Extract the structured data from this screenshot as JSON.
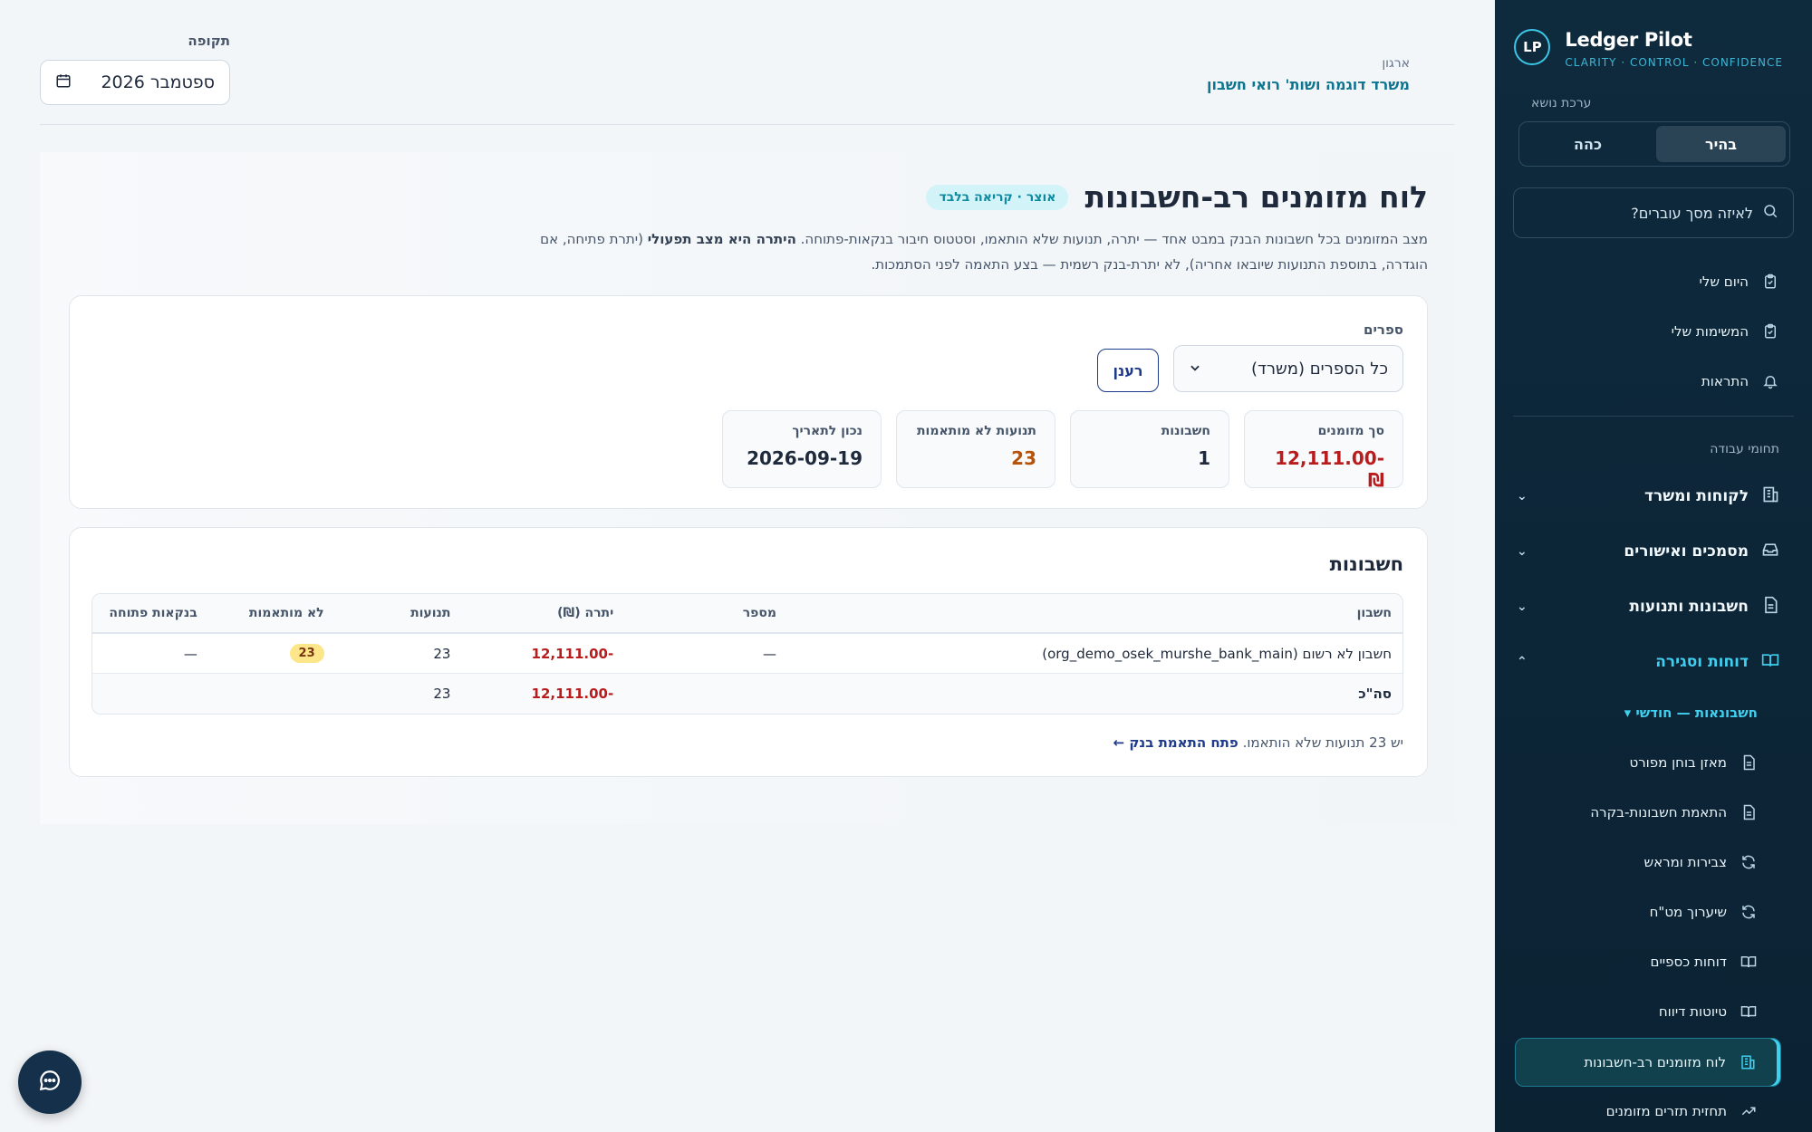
{
  "brand": {
    "initials": "LP",
    "name": "Ledger Pilot",
    "tagline": "CLARITY · CONTROL · CONFIDENCE"
  },
  "sidebar": {
    "theme_label": "ערכת נושא",
    "theme_options": [
      "בהיר",
      "כהה"
    ],
    "search_placeholder": "לאיזה מסך עוברים?",
    "personal": [
      {
        "label": "היום שלי",
        "icon": "clipboard-check-icon"
      },
      {
        "label": "המשימות שלי",
        "icon": "clipboard-check-icon"
      },
      {
        "label": "התראות",
        "icon": "bell-icon"
      }
    ],
    "section_label": "תחומי עבודה",
    "groups": [
      {
        "label": "לקוחות ומשרד",
        "icon": "building-icon"
      },
      {
        "label": "מסמכים ואישורים",
        "icon": "inbox-icon"
      },
      {
        "label": "חשבונות ותנועות",
        "icon": "document-icon"
      },
      {
        "label": "דוחות וסגירה",
        "icon": "book-icon"
      }
    ],
    "subgroup": "חשבונאות — חודשי ▾",
    "leaves": [
      {
        "label": "מאזן בוחן מפורט",
        "icon": "document-icon"
      },
      {
        "label": "התאמת חשבונות-בקרה",
        "icon": "document-icon"
      },
      {
        "label": "צבירות ומראש",
        "icon": "refresh-icon"
      },
      {
        "label": "שיערוך מט\"ח",
        "icon": "refresh-icon"
      },
      {
        "label": "דוחות כספיים",
        "icon": "book-icon"
      },
      {
        "label": "טיוטות דיווח",
        "icon": "book-icon"
      },
      {
        "label": "לוח מזומנים רב-חשבונות",
        "icon": "building-icon"
      },
      {
        "label": "תחזית תזרים מזומנים",
        "icon": "trend-icon"
      }
    ]
  },
  "header": {
    "org_label": "ארגון",
    "org_name": "משרד דוגמה ושות' רואי חשבון",
    "period_label": "תקופה",
    "period_value": "ספטמבר 2026"
  },
  "page": {
    "title": "לוח מזומנים רב-חשבונות",
    "scope_badge": "אוצר · קריאה בלבד",
    "desc_part1": "מצב המזומנים בכל חשבונות הבנק במבט אחד — יתרה, תנועות שלא הותאמו, וסטטוס חיבור בנקאות-פתוחה. ",
    "desc_bold": "היתרה היא מצב תפעולי",
    "desc_part2": " (יתרת פתיחה, אם הוגדרה, בתוספת התנועות שיובאו אחריה), לא יתרת-בנק רשמית — בצע התאמה לפני הסתמכות."
  },
  "filters": {
    "books_label": "ספרים",
    "books_value": "כל הספרים (משרד)",
    "refresh_label": "רענן"
  },
  "stats": [
    {
      "label": "סך מזומנים",
      "value": "-12,111.00 ₪",
      "tone": "neg"
    },
    {
      "label": "חשבונות",
      "value": "1",
      "tone": ""
    },
    {
      "label": "תנועות לא מותאמות",
      "value": "23",
      "tone": "warn"
    },
    {
      "label": "נכון לתאריך",
      "value": "2026-09-19",
      "tone": ""
    }
  ],
  "accounts": {
    "title": "חשבונות",
    "columns": [
      "חשבון",
      "מספר",
      "יתרה (₪)",
      "תנועות",
      "לא מותאמות",
      "בנקאות פתוחה"
    ],
    "rows": [
      {
        "account": "חשבון לא רשום (org_demo_osek_murshe_bank_main)",
        "number": "—",
        "balance": "-12,111.00",
        "txns": "23",
        "unmatched": "23",
        "open_banking": "—"
      }
    ],
    "total": {
      "label": "סה\"כ",
      "balance": "-12,111.00",
      "txns": "23"
    },
    "note_text": "יש 23 תנועות שלא הותאמו.",
    "note_link": "פתח התאמת בנק ←"
  }
}
